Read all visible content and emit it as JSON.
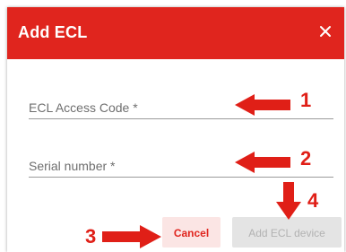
{
  "dialog": {
    "title": "Add ECL",
    "close_glyph": "×",
    "fields": [
      {
        "label": "ECL Access Code *",
        "value": ""
      },
      {
        "label": "Serial number *",
        "value": ""
      }
    ],
    "buttons": {
      "cancel_label": "Cancel",
      "add_label": "Add ECL device"
    }
  },
  "annotations": [
    "1",
    "2",
    "3",
    "4"
  ],
  "colors": {
    "header": "#e0251e",
    "annotation": "#e01f17",
    "cancel_bg": "#fbe5e4",
    "disabled_bg": "#e4e4e4"
  },
  "icons": {
    "close": "close-icon",
    "annotation_arrow": "arrow-icon"
  }
}
